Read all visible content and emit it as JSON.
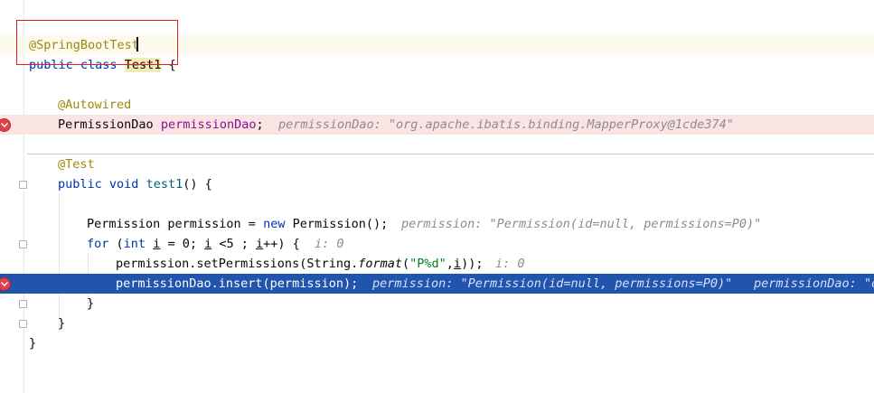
{
  "editor": {
    "lines": {
      "l2": {
        "annotation": "@SpringBootTest"
      },
      "l3": {
        "kw_public": "public",
        "kw_class": "class",
        "class_name": "Test1",
        "brace": "{"
      },
      "l5": {
        "annotation": "@Autowired"
      },
      "l6": {
        "type": "PermissionDao",
        "field": "permissionDao",
        "semi": ";",
        "inline_value": "permissionDao: \"org.apache.ibatis.binding.MapperProxy@1cde374\""
      },
      "l8": {
        "annotation": "@Test"
      },
      "l9": {
        "kw_public": "public",
        "kw_void": "void",
        "method": "test1",
        "rest": "() {"
      },
      "l11": {
        "part1": "Permission permission = ",
        "kw_new": "new",
        "part2": " Permission();",
        "inline_value": "permission: \"Permission(id=null, permissions=P0)\""
      },
      "l12": {
        "kw_for": "for",
        "p1": " (",
        "kw_int": "int",
        "p2": " ",
        "var_i": "i",
        "p3": " = 0; ",
        "var_i2": "i",
        "p4": " <5 ; ",
        "var_i3": "i",
        "p5": "++) {",
        "inline_value": "i: 0"
      },
      "l13": {
        "p1": "permission.setPermissions(String.",
        "fmt": "format",
        "p2": "(",
        "str": "\"P%d\"",
        "p3": ",",
        "var_i": "i",
        "p4": "));",
        "inline_value": "i: 0"
      },
      "l14": {
        "code": "permissionDao.insert(permission);",
        "inline_value1": "permission: \"Permission(id=null, permissions=P0)\"",
        "inline_value2": "permissionDao: \"o"
      },
      "l15": {
        "brace": "}"
      },
      "l16": {
        "brace": "}"
      },
      "l17": {
        "brace": "}"
      }
    },
    "colors": {
      "keyword": "#0033b3",
      "annotation": "#9e880d",
      "field": "#871094",
      "string": "#067d17",
      "execution_line": "#2154ad",
      "breakpoint_line": "#fae3e3",
      "breakpoint": "#e0424a",
      "highlight_box": "#e02020"
    }
  }
}
